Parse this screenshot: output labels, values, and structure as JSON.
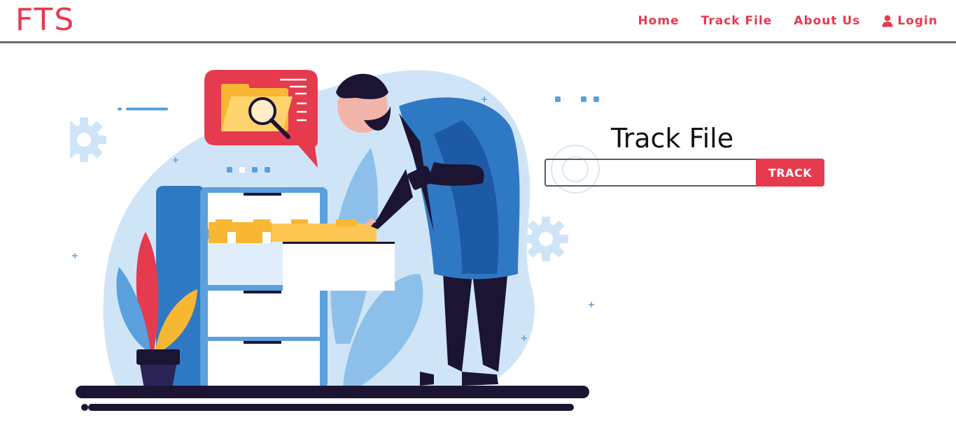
{
  "brand": {
    "name": "FTS",
    "color": "#e63a4e"
  },
  "nav": {
    "home": "Home",
    "track_file": "Track File",
    "about_us": "About Us",
    "login": "Login",
    "login_icon": "user-icon"
  },
  "track": {
    "title": "Track File",
    "input_value": "",
    "input_placeholder": "",
    "button_label": "TRACK"
  },
  "illustration": {
    "subject": "person searching filing cabinet with magnifier speech bubble",
    "icons": [
      "gear-icon",
      "folder-search-icon",
      "plant-icon",
      "phone-icon"
    ]
  },
  "colors": {
    "accent": "#e63a4e",
    "blob": "#cfe5f7",
    "navy": "#1b1433",
    "blue": "#2f78c4",
    "yellow": "#f7b733"
  }
}
